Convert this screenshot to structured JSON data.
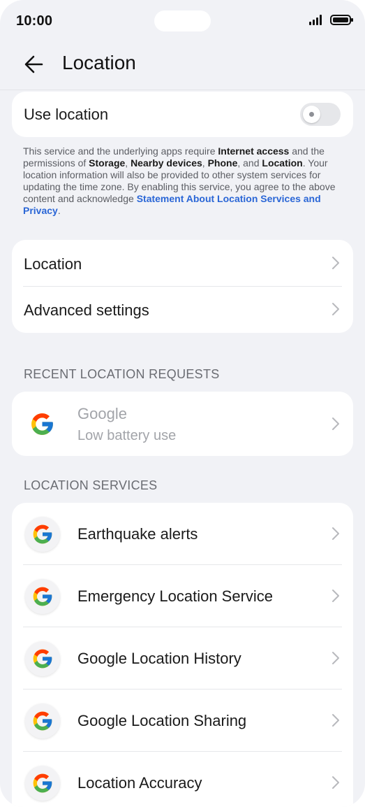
{
  "status": {
    "time": "10:00"
  },
  "header": {
    "title": "Location"
  },
  "use_location": {
    "label": "Use location",
    "enabled": false
  },
  "description": {
    "p1": "This service and the underlying apps require ",
    "internet": "Internet access",
    "p2": " and the permissions of ",
    "storage": "Storage",
    "sep1": ", ",
    "nearby": "Nearby devices",
    "sep2": ", ",
    "phone": "Phone",
    "sep3": ", and ",
    "location": "Location",
    "p3": ". Your location information will also be provided to other system services for updating the time zone. By enabling this service, you agree to the above content and acknowledge ",
    "link": "Statement About Location Services and Privacy",
    "p4": "."
  },
  "settings": {
    "location_label": "Location",
    "advanced_label": "Advanced settings"
  },
  "recent": {
    "header": "RECENT LOCATION REQUESTS",
    "app_name": "Google",
    "app_sub": "Low battery use"
  },
  "services": {
    "header": "LOCATION SERVICES",
    "items": [
      {
        "label": "Earthquake alerts"
      },
      {
        "label": "Emergency Location Service"
      },
      {
        "label": "Google Location History"
      },
      {
        "label": "Google Location Sharing"
      },
      {
        "label": "Location Accuracy"
      }
    ]
  },
  "colors": {
    "background": "#f1f2f6",
    "card": "#ffffff",
    "link": "#2a66d6",
    "google_blue": "#4285F4",
    "google_red": "#EA4335",
    "google_yellow": "#FBBC05",
    "google_green": "#34A853"
  },
  "icons": [
    "signal-icon",
    "battery-icon",
    "back-arrow-icon",
    "chevron-right-icon",
    "google-logo-icon"
  ]
}
